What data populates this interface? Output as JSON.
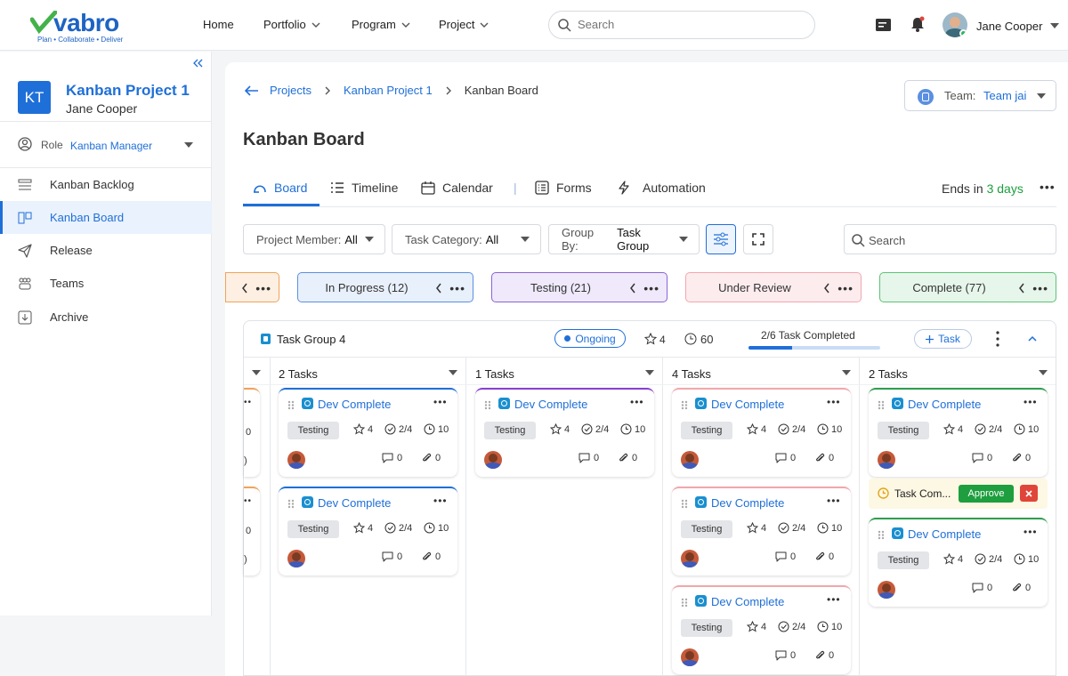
{
  "brand": {
    "name": "vabro",
    "tagline": "Plan • Collaborate • Deliver",
    "colors": {
      "brand": "#1e63c4",
      "accent": "#1f6fd8",
      "green": "#1e9e3e",
      "logo_v": "#43b24a"
    }
  },
  "topnav": {
    "items": [
      {
        "label": "Home",
        "dropdown": false
      },
      {
        "label": "Portfolio",
        "dropdown": true
      },
      {
        "label": "Program",
        "dropdown": true
      },
      {
        "label": "Project",
        "dropdown": true
      }
    ],
    "search_placeholder": "Search",
    "user_name": "Jane Cooper"
  },
  "sidebar": {
    "project_initials": "KT",
    "project_name": "Kanban Project 1",
    "project_owner": "Jane Cooper",
    "role_label": "Role",
    "role_value": "Kanban Manager",
    "items": [
      {
        "label": "Kanban Backlog",
        "icon": "backlog-icon"
      },
      {
        "label": "Kanban Board",
        "icon": "board-icon",
        "active": true
      },
      {
        "label": "Release",
        "icon": "paper-plane-icon"
      },
      {
        "label": "Teams",
        "icon": "teams-icon"
      },
      {
        "label": "Archive",
        "icon": "archive-icon"
      }
    ]
  },
  "breadcrumb": [
    "Projects",
    "Kanban Project 1",
    "Kanban Board"
  ],
  "team": {
    "label": "Team:",
    "value": "Team jai"
  },
  "page_title": "Kanban Board",
  "tabs": [
    {
      "label": "Board",
      "active": true
    },
    {
      "label": "Timeline"
    },
    {
      "label": "Calendar"
    },
    {
      "label": "Forms"
    },
    {
      "label": "Automation"
    }
  ],
  "tab_separator": "|",
  "ends": {
    "prefix": "Ends in",
    "value": "3 days"
  },
  "filters": [
    {
      "label": "Project Member:",
      "value": "All"
    },
    {
      "label": "Task Category:",
      "value": "All"
    },
    {
      "label": "Group By:",
      "value": "Task Group"
    }
  ],
  "board_search_placeholder": "Search",
  "columns": [
    {
      "label": "",
      "bg": "#fdf0e2",
      "border": "#f0a35a"
    },
    {
      "label": "In Progress (12)",
      "bg": "#e8f0fb",
      "border": "#5b8fe0"
    },
    {
      "label": "Testing (21)",
      "bg": "#efe9fb",
      "border": "#8a63d2"
    },
    {
      "label": "Under Review",
      "bg": "#fdecee",
      "border": "#f1a7ad"
    },
    {
      "label": "Complete (77)",
      "bg": "#e7f6ea",
      "border": "#5cc276"
    }
  ],
  "group": {
    "name": "Task Group 4",
    "status": "Ongoing",
    "stars": "4",
    "time": "60",
    "progress_label": "2/6 Task Completed",
    "progress": 0.333,
    "add_task": "Task"
  },
  "lanes": [
    {
      "header": "2 Tasks",
      "color": "#1f6fd8",
      "cards": 2
    },
    {
      "header": "1 Tasks",
      "color": "#8a3fd1",
      "cards": 1
    },
    {
      "header": "4 Tasks",
      "color": "#f1a7ad",
      "cards": 3
    },
    {
      "header": "2 Tasks",
      "color": "#2e9e4f",
      "cards": 2
    }
  ],
  "card": {
    "title": "Dev Complete",
    "badge": "Testing",
    "stars": "4",
    "checklist": "2/4",
    "time": "10",
    "comments": "0",
    "attachments": "0"
  },
  "partial_card": {
    "meta": "0",
    "foot": ")"
  },
  "approval": {
    "text": "Task Com...",
    "approve_label": "Approve"
  }
}
